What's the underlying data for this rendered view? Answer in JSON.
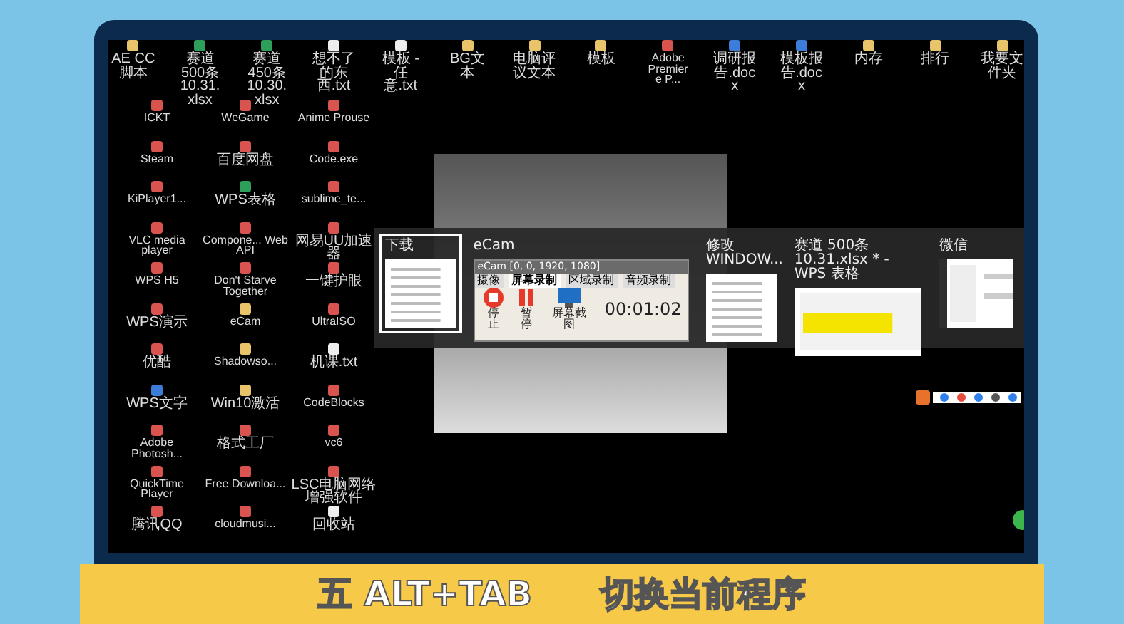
{
  "desktop": {
    "top_icons": [
      {
        "label": "AE CC脚本",
        "kind": "folder"
      },
      {
        "label": "赛道 500条 10.31.xlsx",
        "kind": "sheet"
      },
      {
        "label": "赛道 450条 10.30.xlsx",
        "kind": "sheet"
      },
      {
        "label": "想不了的东西.txt",
        "kind": "file"
      },
      {
        "label": "模板 - 任意.txt",
        "kind": "file"
      },
      {
        "label": "BG文本",
        "kind": "folder"
      },
      {
        "label": "电脑评议文本",
        "kind": "folder"
      },
      {
        "label": "模板",
        "kind": "folder"
      },
      {
        "label": "Adobe Premiere P...",
        "kind": "app"
      },
      {
        "label": "调研报告.docx",
        "kind": "doc"
      },
      {
        "label": "模板报告.docx",
        "kind": "doc"
      },
      {
        "label": "内存",
        "kind": "folder"
      },
      {
        "label": "排行",
        "kind": "folder"
      },
      {
        "label": "我要文件夹",
        "kind": "folder"
      }
    ],
    "left_icons": [
      {
        "label": "ICKT",
        "kind": "app"
      },
      {
        "label": "WeGame",
        "kind": "app"
      },
      {
        "label": "Anime Prouse",
        "kind": "app"
      },
      {
        "label": "Steam",
        "kind": "app"
      },
      {
        "label": "百度网盘",
        "kind": "app"
      },
      {
        "label": "Code.exe",
        "kind": "app"
      },
      {
        "label": "KiPlayer1...",
        "kind": "app"
      },
      {
        "label": "WPS表格",
        "kind": "sheet"
      },
      {
        "label": "sublime_te...",
        "kind": "app"
      },
      {
        "label": "VLC media player",
        "kind": "app"
      },
      {
        "label": "Compone... Web API",
        "kind": "app"
      },
      {
        "label": "网易UU加速器",
        "kind": "app"
      },
      {
        "label": "WPS H5",
        "kind": "app"
      },
      {
        "label": "Don't Starve Together",
        "kind": "app"
      },
      {
        "label": "一键护眼",
        "kind": "app"
      },
      {
        "label": "WPS演示",
        "kind": "app"
      },
      {
        "label": "eCam",
        "kind": "folder"
      },
      {
        "label": "UltraISO",
        "kind": "app"
      },
      {
        "label": "优酷",
        "kind": "app"
      },
      {
        "label": "Shadowso...",
        "kind": "folder"
      },
      {
        "label": "机课.txt",
        "kind": "file"
      },
      {
        "label": "WPS文字",
        "kind": "doc"
      },
      {
        "label": "Win10激活",
        "kind": "folder"
      },
      {
        "label": "CodeBlocks",
        "kind": "app"
      },
      {
        "label": "Adobe Photosh...",
        "kind": "app"
      },
      {
        "label": "格式工厂",
        "kind": "app"
      },
      {
        "label": "vc6",
        "kind": "app"
      },
      {
        "label": "QuickTime Player",
        "kind": "app"
      },
      {
        "label": "Free Downloa...",
        "kind": "app"
      },
      {
        "label": "LSC电脑网络增强软件",
        "kind": "app"
      },
      {
        "label": "腾讯QQ",
        "kind": "app"
      },
      {
        "label": "cloudmusi...",
        "kind": "app"
      },
      {
        "label": "回收站",
        "kind": "file"
      }
    ]
  },
  "switcher": {
    "windows": [
      {
        "title": "下载",
        "kind": "list",
        "selected": true
      },
      {
        "title": "eCam",
        "kind": "ecam",
        "selected": false
      },
      {
        "title": "修改WINDOW...",
        "kind": "list",
        "selected": false
      },
      {
        "title": "赛道 500条10.31.xlsx * - WPS 表格",
        "kind": "sheet",
        "selected": false
      },
      {
        "title": "微信",
        "kind": "chat",
        "selected": false
      }
    ]
  },
  "ecam": {
    "title": "eCam [0, 0, 1920, 1080]",
    "tabs": [
      {
        "label": "摄像",
        "selected": false
      },
      {
        "label": "屏幕录制",
        "selected": true
      },
      {
        "label": "区域录制",
        "selected": false
      },
      {
        "label": "音频录制",
        "selected": false
      }
    ],
    "buttons": [
      {
        "label": "停止",
        "kind": "stop"
      },
      {
        "label": "暂停",
        "kind": "pause"
      },
      {
        "label": "屏幕截图",
        "kind": "screen"
      }
    ],
    "timer": "00:01:02"
  },
  "caption": {
    "keys": "五 ALT+TAB",
    "text": "切换当前程序"
  }
}
